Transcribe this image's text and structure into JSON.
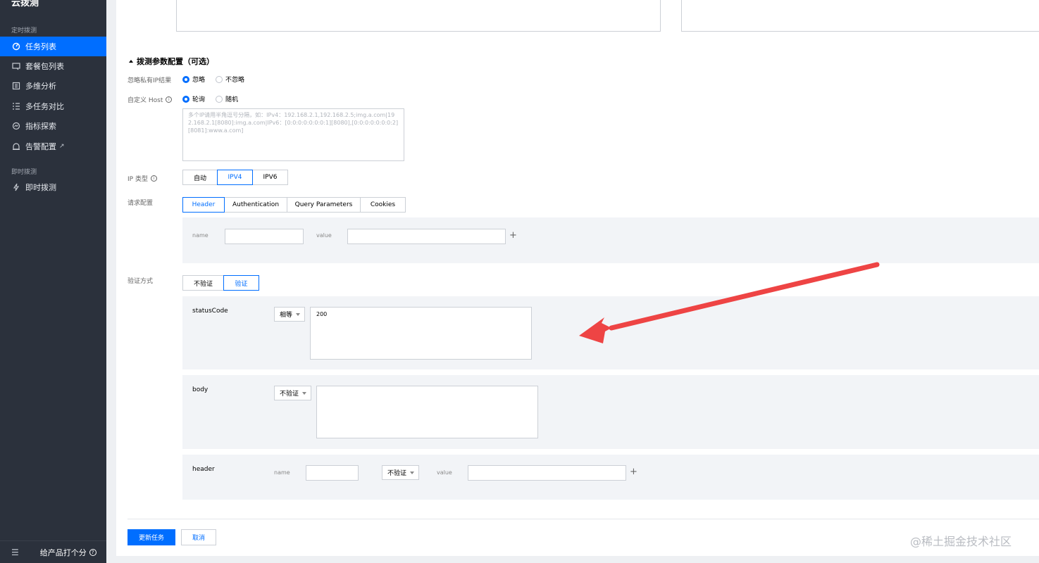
{
  "sidebar": {
    "brand": "云拨测",
    "sections": [
      {
        "label": "定时拨测"
      },
      {
        "label": "即时拨测"
      }
    ],
    "items": [
      {
        "label": "任务列表",
        "icon": "gauge-icon",
        "active": true
      },
      {
        "label": "套餐包列表",
        "icon": "package-icon"
      },
      {
        "label": "多维分析",
        "icon": "analysis-icon"
      },
      {
        "label": "多任务对比",
        "icon": "list-icon"
      },
      {
        "label": "指标探索",
        "icon": "explore-icon"
      },
      {
        "label": "告警配置",
        "icon": "alarm-icon",
        "external": "↗"
      },
      {
        "label": "即时拨测",
        "icon": "bolt-icon"
      }
    ],
    "bottom": {
      "menu_icon": "☰",
      "rate_label": "给产品打个分",
      "help": "?"
    }
  },
  "form": {
    "section_title": "拨测参数配置（可选）",
    "ignore_private_ip": {
      "label": "忽略私有IP结果",
      "options": [
        "忽略",
        "不忽略"
      ],
      "selected": "忽略"
    },
    "custom_host": {
      "label": "自定义 Host",
      "options": [
        "轮询",
        "随机"
      ],
      "selected": "轮询",
      "placeholder": "多个IP请用半角逗号分隔，如：IPv4：192.168.2.1,192.168.2.5;img.a.com|192.168.2.1[8080]:img.a.com|IPv6：[0:0:0:0:0:0:0:1][8080],[0:0:0:0:0:0:0:2][8081]:www.a.com]"
    },
    "ip_type": {
      "label": "IP 类型",
      "options": [
        "自动",
        "IPV4",
        "IPV6"
      ],
      "selected": "IPV4"
    },
    "request_config": {
      "label": "请求配置",
      "tabs": [
        "Header",
        "Authentication",
        "Query Parameters",
        "Cookies"
      ],
      "selected": "Header",
      "name_label": "name",
      "value_label": "value",
      "add": "+"
    },
    "verify": {
      "label": "验证方式",
      "options": [
        "不验证",
        "验证"
      ],
      "selected": "验证",
      "status_code": {
        "label": "statusCode",
        "operator": "相等",
        "value": "200"
      },
      "body": {
        "label": "body",
        "operator": "不验证",
        "value": ""
      },
      "header": {
        "label": "header",
        "name_label": "name",
        "operator": "不验证",
        "value_label": "value",
        "add": "+"
      }
    },
    "actions": {
      "submit": "更新任务",
      "cancel": "取消"
    }
  },
  "watermark": "@稀土掘金技术社区",
  "colors": {
    "accent": "#006eff",
    "sidebar_bg": "#2b313c",
    "annotation_arrow": "#ee4444"
  }
}
